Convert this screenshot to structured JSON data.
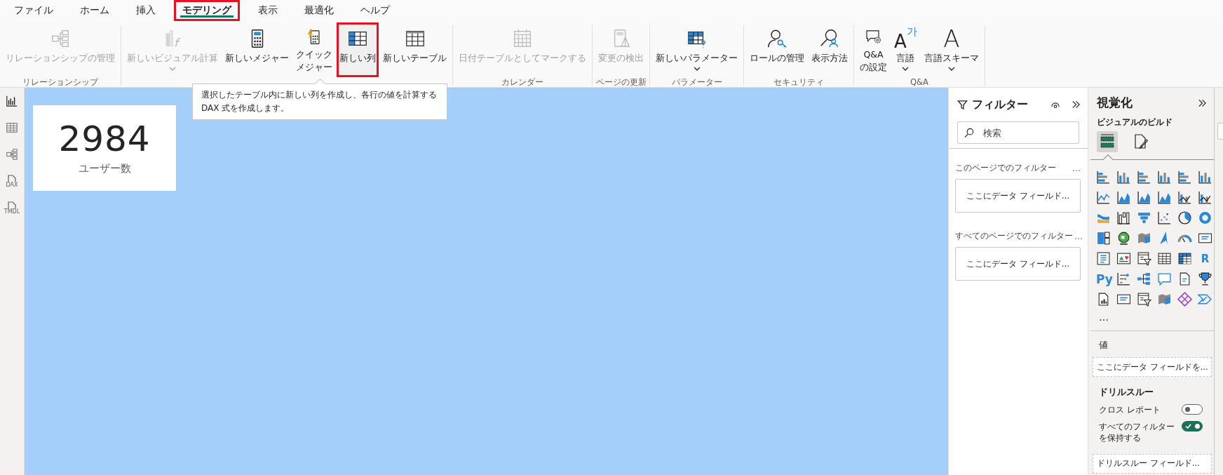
{
  "tabs": [
    {
      "label": "ファイル",
      "selected": false,
      "highlighted": false
    },
    {
      "label": "ホーム",
      "selected": false,
      "highlighted": false
    },
    {
      "label": "挿入",
      "selected": false,
      "highlighted": false
    },
    {
      "label": "モデリング",
      "selected": true,
      "highlighted": true
    },
    {
      "label": "表示",
      "selected": false,
      "highlighted": false
    },
    {
      "label": "最適化",
      "selected": false,
      "highlighted": false
    },
    {
      "label": "ヘルプ",
      "selected": false,
      "highlighted": false
    }
  ],
  "ribbon": {
    "groups": [
      {
        "label": "リレーションシップ",
        "buttons": [
          {
            "label": "リレーションシップの管理",
            "disabled": true,
            "dropdown": false,
            "highlighted": false
          }
        ]
      },
      {
        "buttons": [
          {
            "label": "新しいビジュアル計算",
            "disabled": true,
            "dropdown": true,
            "highlighted": false
          },
          {
            "label": "新しいメジャー",
            "disabled": false,
            "dropdown": false,
            "highlighted": false
          },
          {
            "label": [
              "クイック",
              "メジャー"
            ],
            "disabled": false,
            "dropdown": false,
            "highlighted": false
          },
          {
            "label": "新しい列",
            "disabled": false,
            "dropdown": false,
            "highlighted": true
          },
          {
            "label": "新しいテーブル",
            "disabled": false,
            "dropdown": false,
            "highlighted": false
          }
        ]
      },
      {
        "label": "カレンダー",
        "buttons": [
          {
            "label": "日付テーブルとしてマークする",
            "disabled": true,
            "dropdown": false,
            "highlighted": false
          }
        ]
      },
      {
        "label": "ページの更新",
        "buttons": [
          {
            "label": "変更の検出",
            "disabled": true,
            "dropdown": false,
            "highlighted": false
          }
        ]
      },
      {
        "label": "パラメーター",
        "buttons": [
          {
            "label": "新しいパラメーター",
            "disabled": false,
            "dropdown": true,
            "highlighted": false
          }
        ]
      },
      {
        "label": "セキュリティ",
        "buttons": [
          {
            "label": "ロールの管理",
            "disabled": false,
            "dropdown": false,
            "highlighted": false
          },
          {
            "label": "表示方法",
            "disabled": false,
            "dropdown": false,
            "highlighted": false
          }
        ]
      },
      {
        "label": "Q&A",
        "buttons": [
          {
            "label": [
              "Q&A",
              "の設定"
            ],
            "disabled": false,
            "dropdown": false,
            "highlighted": false
          },
          {
            "label": "言語",
            "glyph": [
              "A",
              "가"
            ],
            "disabled": false,
            "dropdown": true,
            "highlighted": false
          },
          {
            "label": "言語スキーマ",
            "glyph": [
              "A"
            ],
            "disabled": false,
            "dropdown": true,
            "highlighted": false
          }
        ]
      }
    ]
  },
  "tooltip": {
    "lines": [
      "選択したテーブル内に新しい列を作成し、各行の値を計算する",
      "DAX 式を作成します。"
    ]
  },
  "sidebar": {
    "views": [
      {
        "selected": true
      },
      {
        "selected": false
      },
      {
        "selected": false
      },
      {
        "selected": false,
        "badge": "DAX"
      },
      {
        "selected": false,
        "badge": "TMDL"
      }
    ]
  },
  "card": {
    "value": "2984",
    "label": "ユーザー数"
  },
  "filters": {
    "title": "フィルター",
    "search_placeholder": "検索",
    "sections": [
      {
        "title": "このページでのフィルター",
        "more": "…",
        "drop": "ここにデータ フィールド..."
      },
      {
        "title": "すべてのページでのフィルター",
        "more": "…",
        "drop": "ここにデータ フィールド..."
      }
    ]
  },
  "visualizations": {
    "title": "視覚化",
    "subtitle": "ビジュアルのビルド",
    "build_tabs": [
      {
        "selected": true
      },
      {
        "selected": false
      }
    ],
    "gallery_labels": [
      "R",
      "Py"
    ],
    "gallery_more": "…",
    "values_label": "値",
    "values_drop": "ここにデータ フィールドを...",
    "drill_title": "ドリルスルー",
    "toggles": [
      {
        "label": "クロス レポート",
        "on": false
      },
      {
        "label": [
          "すべてのフィルター",
          "を保持する"
        ],
        "on": true
      }
    ],
    "drill_drop": "ドリルスルー フィールド..."
  }
}
